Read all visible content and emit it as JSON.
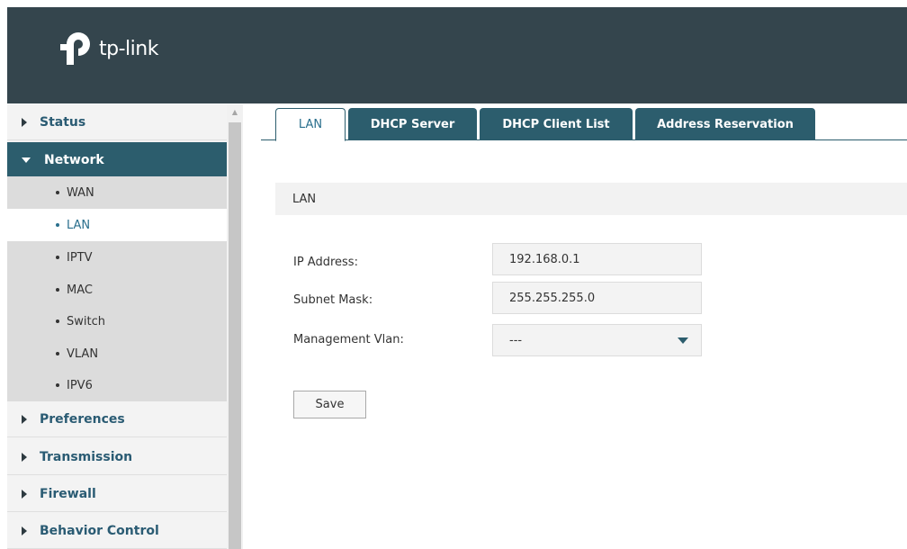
{
  "brand": {
    "name": "tp-link",
    "header_color": "#34454d",
    "accent": "#2c5d6d"
  },
  "sidebar": {
    "items": [
      {
        "label": "Status",
        "icon": "caret-right-icon"
      },
      {
        "label": "Network",
        "icon": "caret-down-icon",
        "expanded": true
      },
      {
        "label": "Preferences",
        "icon": "caret-right-icon"
      },
      {
        "label": "Transmission",
        "icon": "caret-right-icon"
      },
      {
        "label": "Firewall",
        "icon": "caret-right-icon"
      },
      {
        "label": "Behavior Control",
        "icon": "caret-right-icon"
      }
    ],
    "network_sub": [
      "WAN",
      "LAN",
      "IPTV",
      "MAC",
      "Switch",
      "VLAN",
      "IPV6"
    ],
    "selected_sub": "LAN"
  },
  "tabs": [
    {
      "label": "LAN",
      "active": true
    },
    {
      "label": "DHCP Server"
    },
    {
      "label": "DHCP Client List"
    },
    {
      "label": "Address Reservation"
    }
  ],
  "section": {
    "title": "LAN"
  },
  "form": {
    "ip_label": "IP Address:",
    "ip_value": "192.168.0.1",
    "mask_label": "Subnet Mask:",
    "mask_value": "255.255.255.0",
    "vlan_label": "Management Vlan:",
    "vlan_value": "---"
  },
  "actions": {
    "save_label": "Save"
  }
}
